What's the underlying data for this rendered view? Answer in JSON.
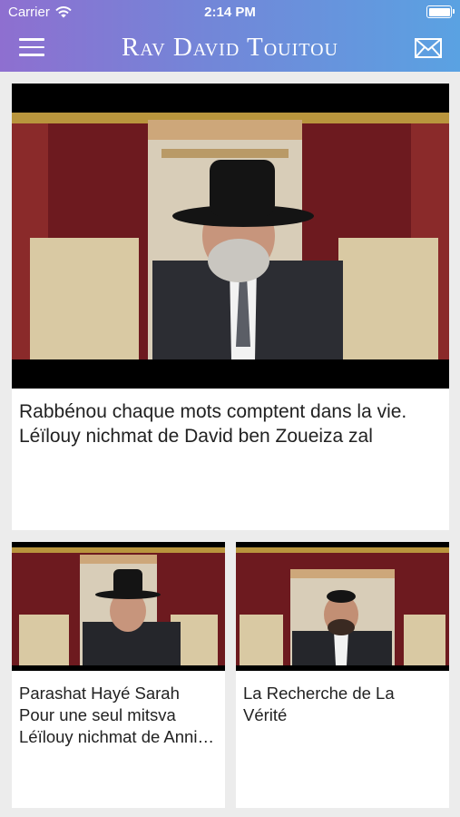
{
  "status_bar": {
    "carrier": "Carrier",
    "time": "2:14 PM"
  },
  "header": {
    "title": "Rav David Touitou"
  },
  "icons": {
    "menu": "hamburger-menu-icon",
    "mail": "envelope-icon",
    "wifi": "wifi-icon",
    "battery": "battery-icon"
  },
  "colors": {
    "header_start": "#8e6fd0",
    "header_end": "#5aa2e2",
    "background": "#ececec"
  },
  "videos": [
    {
      "title": "Rabbénou  chaque mots comptent dans la vie. Léïlouy nichmat de David ben Zoueiza zal"
    },
    {
      "title": "Parashat Hayé Sarah Pour une seul mitsva Léïlouy nichmat de Annie Rouma bat Esther"
    },
    {
      "title": "La Recherche de La Vérité"
    }
  ]
}
